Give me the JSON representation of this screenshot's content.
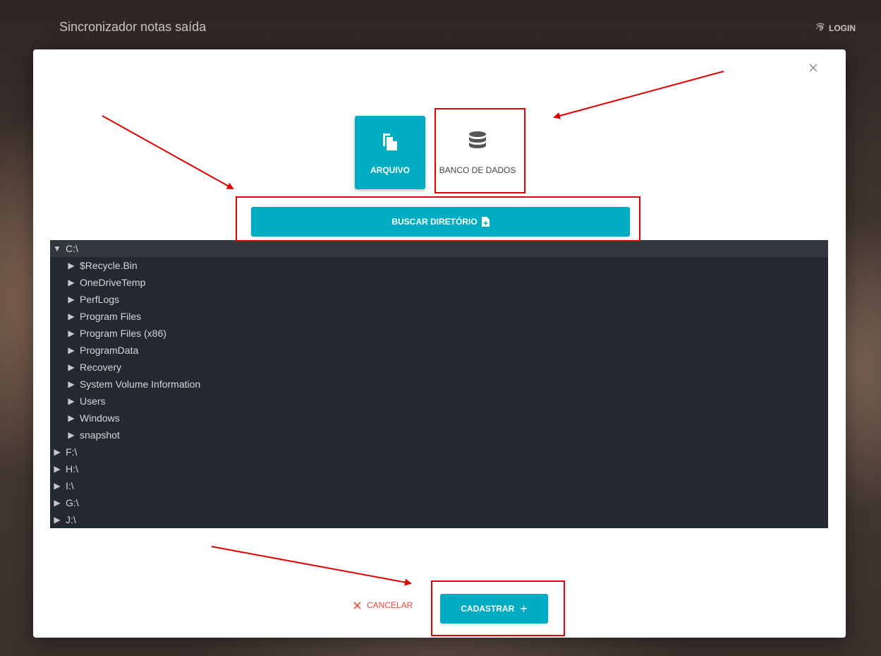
{
  "header": {
    "app_title": "Sincronizador notas saída",
    "login_label": "LOGIN"
  },
  "modal": {
    "source_tabs": [
      {
        "label": "ARQUIVO",
        "icon": "file-copy-icon",
        "active": true
      },
      {
        "label": "BANCO DE DADOS",
        "icon": "database-icon",
        "active": false
      }
    ],
    "search_dir_label": "BUSCAR DIRETÓRIO",
    "tree": [
      {
        "label": "C:\\",
        "level": 0,
        "expanded": true,
        "selected": true
      },
      {
        "label": "$Recycle.Bin",
        "level": 1,
        "expanded": false
      },
      {
        "label": "OneDriveTemp",
        "level": 1,
        "expanded": false
      },
      {
        "label": "PerfLogs",
        "level": 1,
        "expanded": false
      },
      {
        "label": "Program Files",
        "level": 1,
        "expanded": false
      },
      {
        "label": "Program Files (x86)",
        "level": 1,
        "expanded": false
      },
      {
        "label": "ProgramData",
        "level": 1,
        "expanded": false
      },
      {
        "label": "Recovery",
        "level": 1,
        "expanded": false
      },
      {
        "label": "System Volume Information",
        "level": 1,
        "expanded": false
      },
      {
        "label": "Users",
        "level": 1,
        "expanded": false
      },
      {
        "label": "Windows",
        "level": 1,
        "expanded": false
      },
      {
        "label": "snapshot",
        "level": 1,
        "expanded": false
      },
      {
        "label": "F:\\",
        "level": 0,
        "expanded": false
      },
      {
        "label": "H:\\",
        "level": 0,
        "expanded": false
      },
      {
        "label": "I:\\",
        "level": 0,
        "expanded": false
      },
      {
        "label": "G:\\",
        "level": 0,
        "expanded": false
      },
      {
        "label": "J:\\",
        "level": 0,
        "expanded": false
      }
    ],
    "cancel_label": "CANCELAR",
    "submit_label": "CADASTRAR"
  },
  "colors": {
    "accent": "#00acc1",
    "tree_bg": "#242830",
    "cancel": "#f44336",
    "annotation": "#e00000"
  }
}
